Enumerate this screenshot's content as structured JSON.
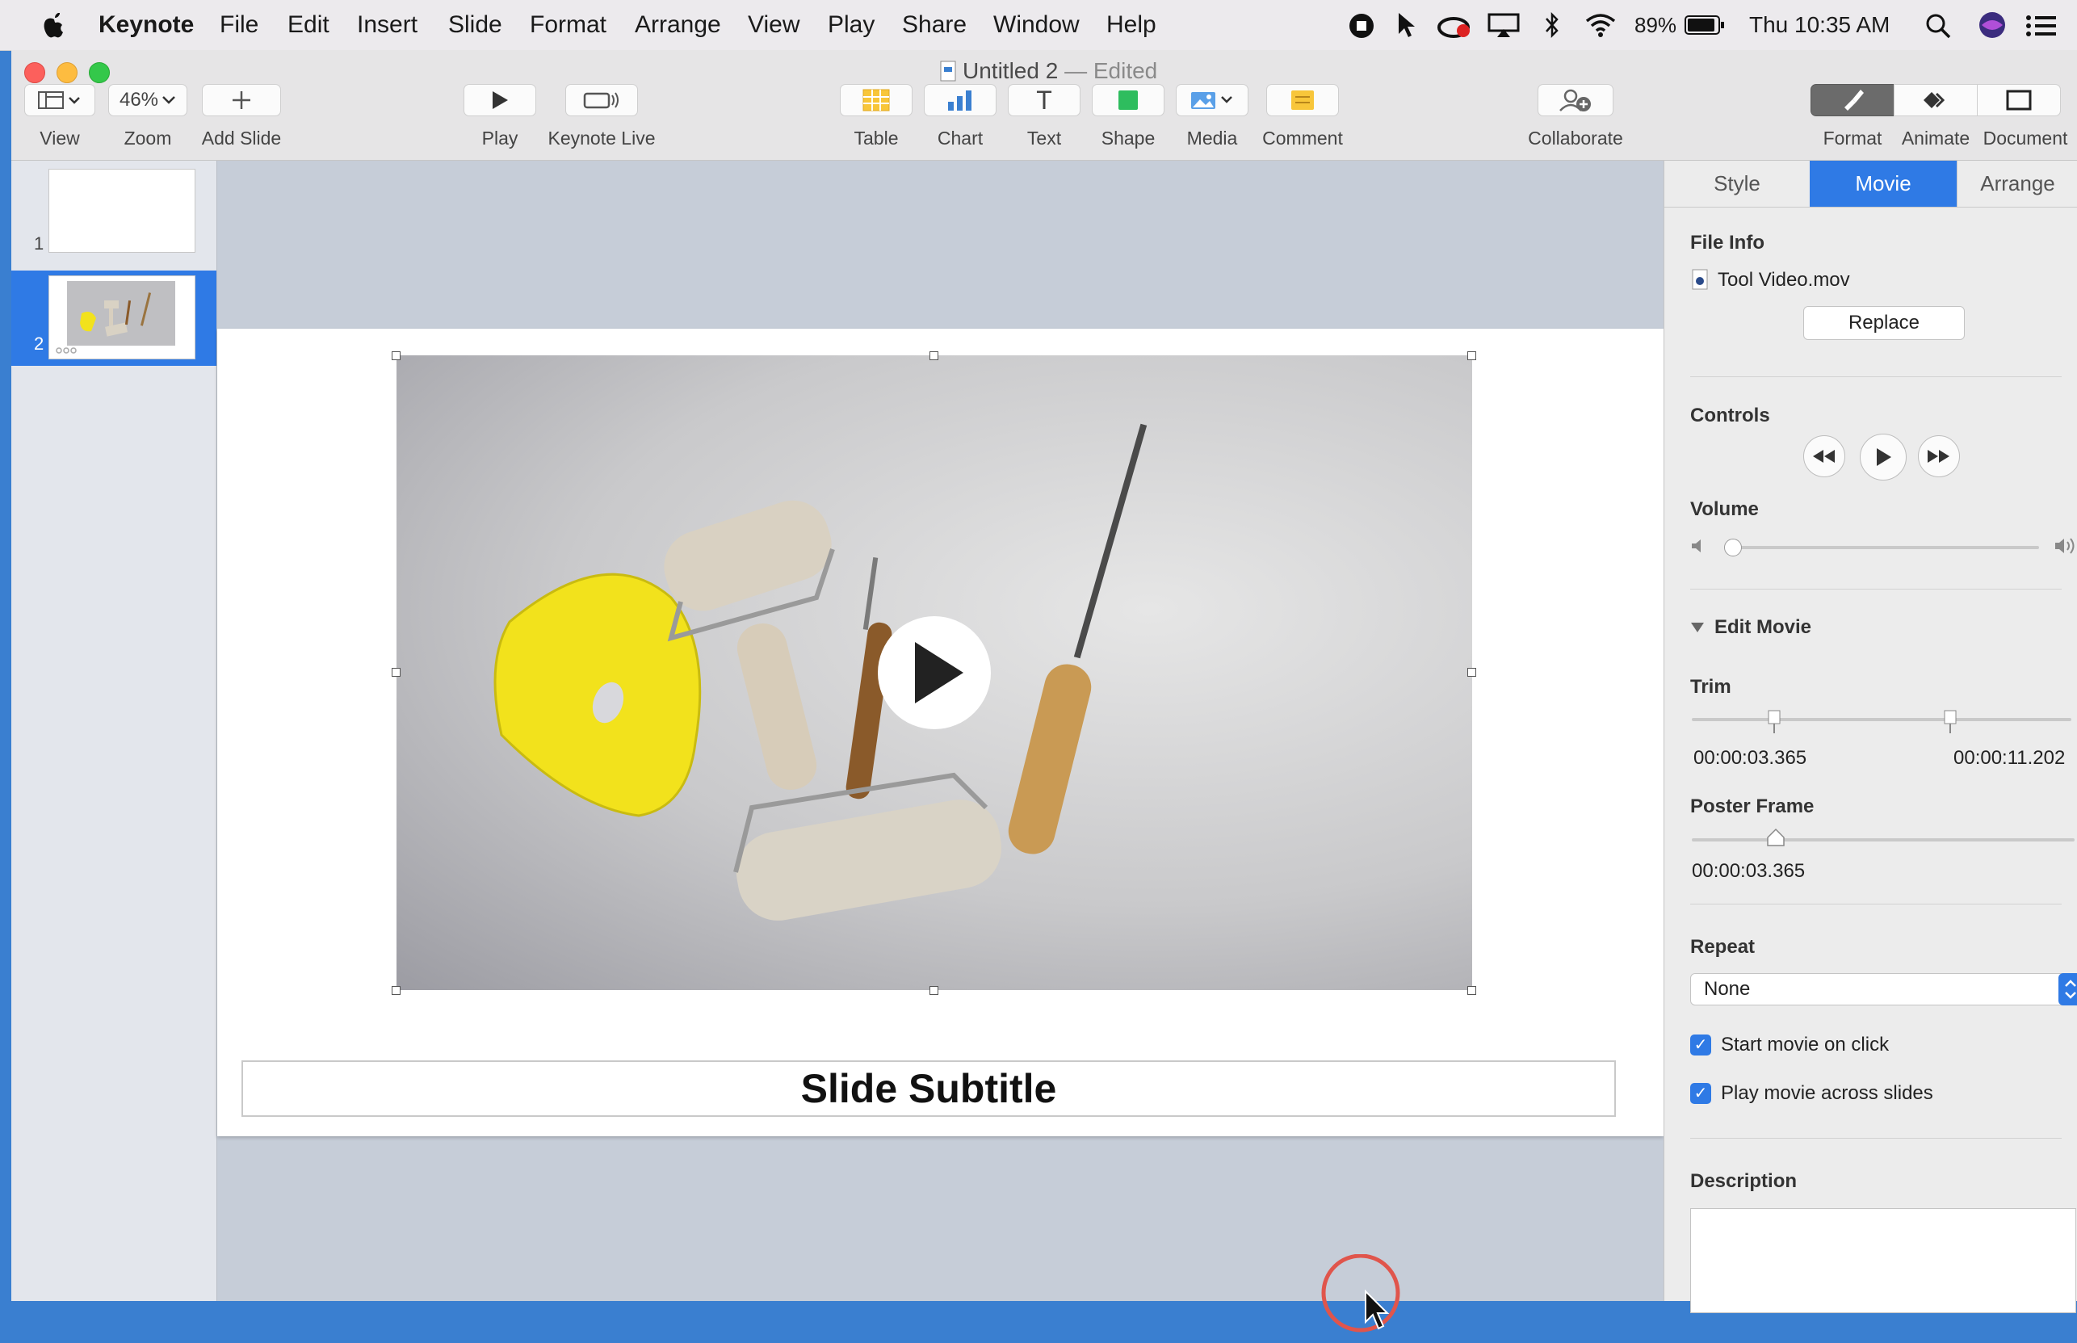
{
  "menubar": {
    "app": "Keynote",
    "items": [
      "File",
      "Edit",
      "Insert",
      "Slide",
      "Format",
      "Arrange",
      "View",
      "Play",
      "Share",
      "Window",
      "Help"
    ],
    "battery": "89%",
    "clock": "Thu 10:35 AM"
  },
  "window": {
    "title": "Untitled 2",
    "edited": "— Edited"
  },
  "toolbar": {
    "view": "View",
    "zoom_value": "46%",
    "zoom": "Zoom",
    "add_slide": "Add Slide",
    "play": "Play",
    "keynote_live": "Keynote Live",
    "table": "Table",
    "chart": "Chart",
    "text": "Text",
    "shape": "Shape",
    "media": "Media",
    "comment": "Comment",
    "collaborate": "Collaborate",
    "format": "Format",
    "animate": "Animate",
    "document": "Document",
    "text_glyph": "T"
  },
  "slides": [
    {
      "number": "1"
    },
    {
      "number": "2"
    }
  ],
  "slide": {
    "subtitle": "Slide Subtitle"
  },
  "inspector": {
    "tabs": [
      "Style",
      "Movie",
      "Arrange"
    ],
    "active_tab": "Movie",
    "file_info_label": "File Info",
    "file_name": "Tool Video.mov",
    "replace": "Replace",
    "controls_label": "Controls",
    "volume_label": "Volume",
    "volume_level": 0,
    "edit_movie_label": "Edit Movie",
    "trim_label": "Trim",
    "trim_start": "00:00:03.365",
    "trim_end": "00:00:11.202",
    "poster_frame_label": "Poster Frame",
    "poster_frame_time": "00:00:03.365",
    "repeat_label": "Repeat",
    "repeat_value": "None",
    "start_on_click": "Start movie on click",
    "play_across": "Play movie across slides",
    "description_label": "Description"
  },
  "colors": {
    "accent": "#2f7ae5",
    "yellow_tool": "#f2e21c"
  }
}
